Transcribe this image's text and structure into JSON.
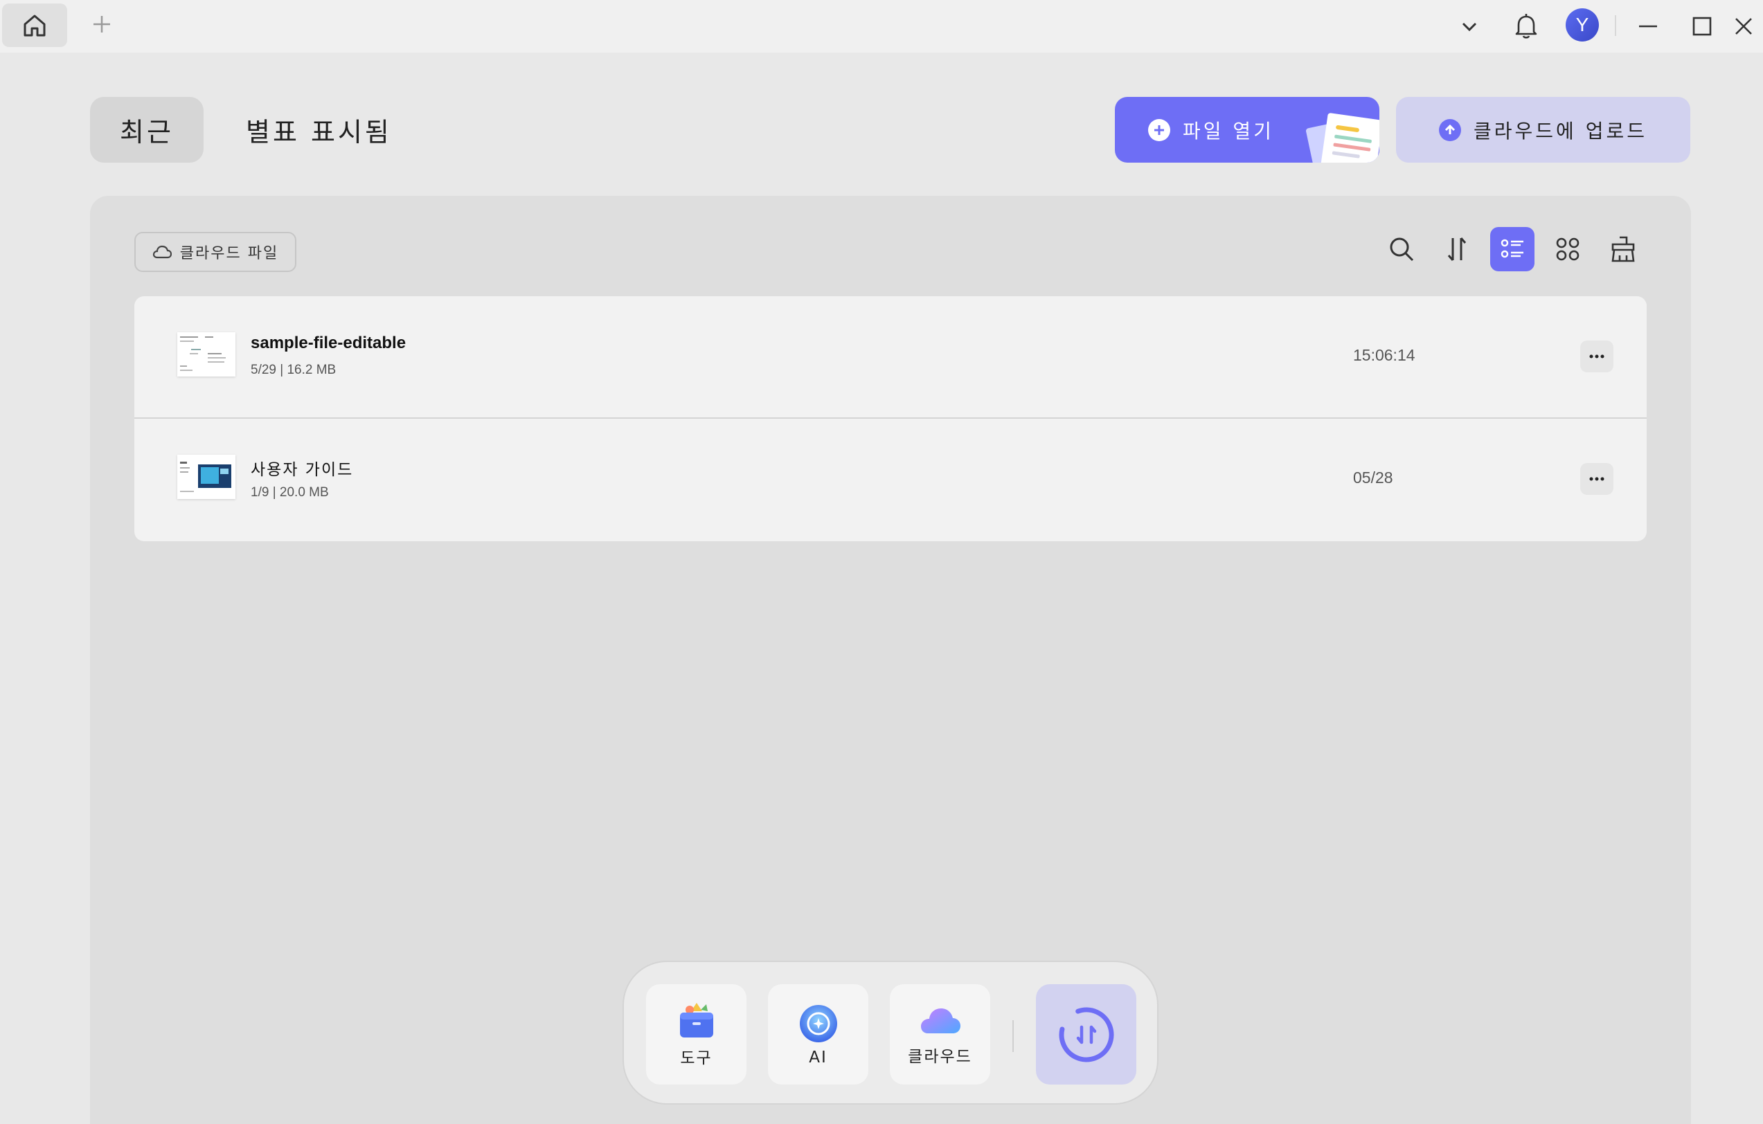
{
  "titlebar": {
    "avatar_initial": "Y",
    "icons": [
      "home-icon",
      "plus-icon",
      "chevron-down-icon",
      "bell-icon",
      "minimize-icon",
      "maximize-icon",
      "close-icon"
    ]
  },
  "header": {
    "tab_recent": "최근",
    "tab_starred": "별표 표시됨",
    "open_file_label": "파일 열기",
    "upload_label": "클라우드에 업로드"
  },
  "panel": {
    "cloud_files_label": "클라우드 파일",
    "toolbar_icons": [
      "search-icon",
      "sort-icon",
      "list-view-icon",
      "grid-view-icon",
      "clean-icon"
    ]
  },
  "files": [
    {
      "name": "sample-file-editable",
      "meta": "5/29 | 16.2 MB",
      "time": "15:06:14"
    },
    {
      "name": "사용자 가이드",
      "meta": "1/9 | 20.0 MB",
      "time": "05/28"
    }
  ],
  "dock": {
    "tools_label": "도구",
    "ai_label": "AI",
    "cloud_label": "클라우드"
  },
  "colors": {
    "accent": "#6e6ef5",
    "accent_light": "#d2d2ef",
    "background": "#e8e8e8",
    "panel": "#dedede"
  }
}
